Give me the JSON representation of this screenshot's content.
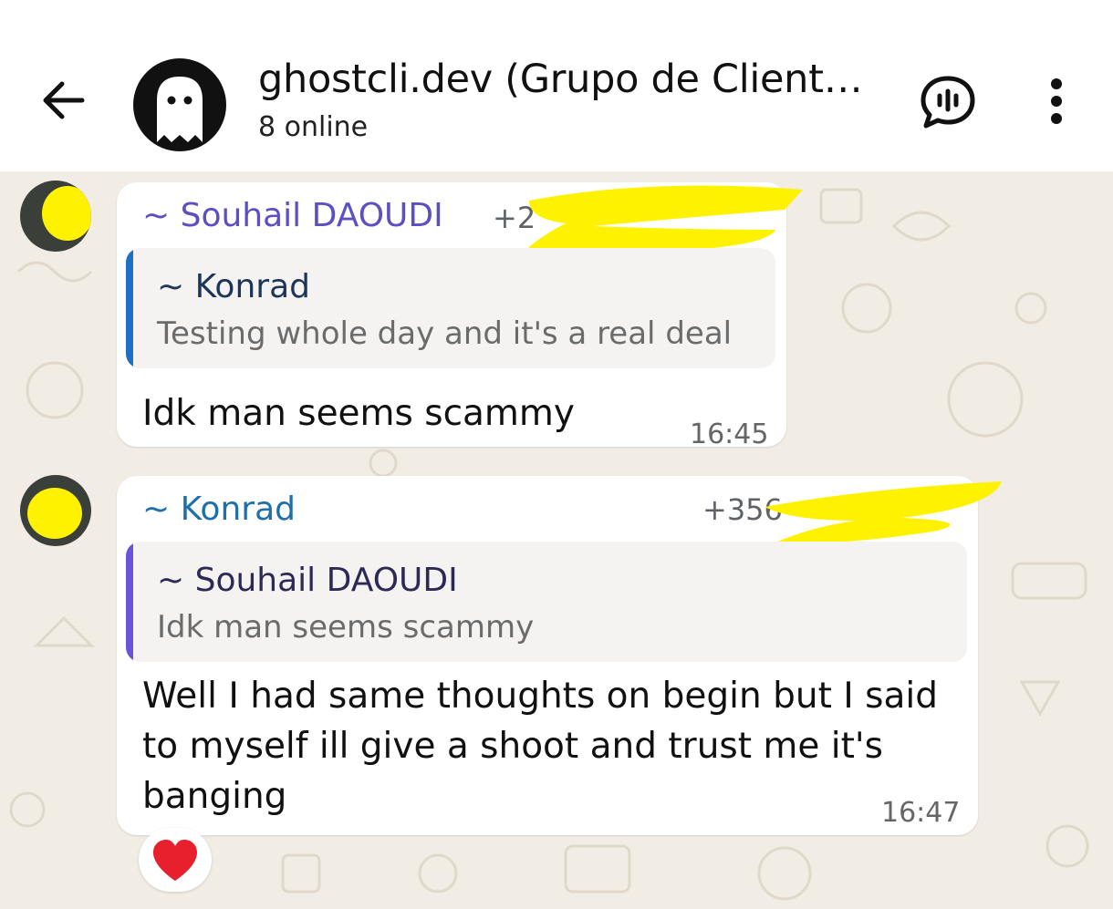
{
  "header": {
    "title": "ghostcli.dev (Grupo de Client…",
    "subtitle": "8 online"
  },
  "messages": [
    {
      "sender": "~ Souhail DAOUDI",
      "sender_color": "#5b4fc2",
      "phone_visible": "+2",
      "quote": {
        "sender": "~ Konrad",
        "text": "Testing whole day  and it's a real deal",
        "bar_color": "#1f6fc5"
      },
      "text": "Idk man seems scammy",
      "time": "16:45"
    },
    {
      "sender": "~ Konrad",
      "sender_color": "#1f6fa8",
      "phone_visible": "+356",
      "quote": {
        "sender": "~ Souhail DAOUDI",
        "text": "Idk man seems scammy",
        "bar_color": "#6a55d8"
      },
      "text": "Well I had same thoughts   on begin but I said to myself ill give a shoot and trust me it's banging",
      "time": "16:47",
      "reaction": "❤️"
    }
  ],
  "colors": {
    "chat_bg": "#f2ede4",
    "redaction": "#fff200"
  }
}
